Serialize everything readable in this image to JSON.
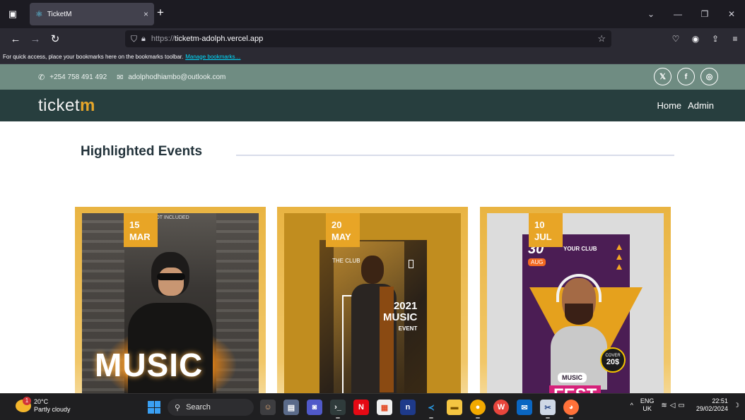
{
  "browser": {
    "tab_title": "TicketM",
    "tab_close": "×",
    "new_tab": "+",
    "url_protocol": "https://",
    "url_host": "ticketm-adolph.vercel.app",
    "bookmarks_text": "For quick access, place your bookmarks here on the bookmarks toolbar.",
    "bookmarks_link": "Manage bookmarks…"
  },
  "site": {
    "phone": "+254 758 491 492",
    "email": "adolphodhiambo@outlook.com",
    "logo_main": "ticket",
    "logo_accent": "m",
    "nav": [
      {
        "label": "Home"
      },
      {
        "label": "Admin"
      }
    ],
    "socials": [
      {
        "label": "𝕏",
        "icon": "x-icon"
      },
      {
        "label": "f",
        "icon": "facebook-icon"
      },
      {
        "label": "◎",
        "icon": "instagram-icon"
      }
    ]
  },
  "section": {
    "title": "Highlighted Events"
  },
  "events": [
    {
      "day": "15",
      "month": "MAR",
      "poster_text": "MUSIC",
      "poster_tiny": "ES NOT INCLUDED"
    },
    {
      "day": "20",
      "month": "MAY",
      "poster_year": "2021",
      "poster_word": "MUSIC",
      "poster_sub": "EVENT",
      "poster_club": "THE CLUB"
    },
    {
      "day": "10",
      "month": "JUL",
      "poster_day": "30",
      "poster_month": "AUG",
      "poster_club": "YOUR CLUB",
      "poster_cover": "COVER",
      "poster_price": "20$",
      "poster_music": "MUSIC",
      "poster_fest": "FEST"
    }
  ],
  "taskbar": {
    "temp": "20°C",
    "weather": "Partly cloudy",
    "weather_badge": "1",
    "search": "Search",
    "lang_top": "ENG",
    "lang_bottom": "UK",
    "time": "22:51",
    "date": "29/02/2024"
  },
  "colors": {
    "accent": "#e8a526",
    "header": "#273e3e",
    "contactbar": "#6f8c82"
  }
}
